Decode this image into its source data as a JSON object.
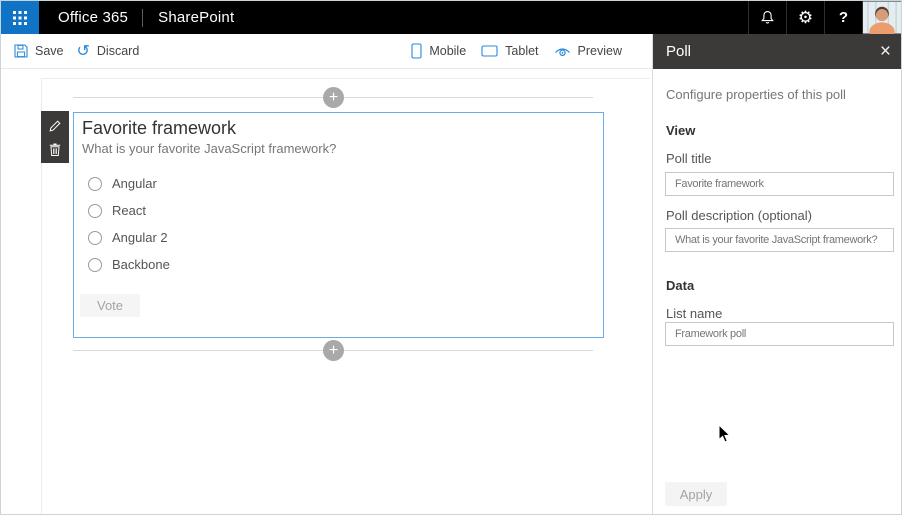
{
  "suite_bar": {
    "brand": "Office 365",
    "product": "SharePoint",
    "help_label": "?"
  },
  "toolbar": {
    "save_label": "Save",
    "discard_label": "Discard",
    "mobile_label": "Mobile",
    "tablet_label": "Tablet",
    "preview_label": "Preview"
  },
  "canvas": {
    "webpart": {
      "title": "Favorite framework",
      "description": "What is your favorite JavaScript framework?",
      "options": [
        "Angular",
        "React",
        "Angular 2",
        "Backbone"
      ],
      "vote_label": "Vote"
    }
  },
  "panel": {
    "title": "Poll",
    "subtitle": "Configure properties of this poll",
    "view": {
      "heading": "View",
      "poll_title_label": "Poll title",
      "poll_title_value": "Favorite framework",
      "poll_description_label": "Poll description (optional)",
      "poll_description_value": "What is your favorite JavaScript framework?"
    },
    "data": {
      "heading": "Data",
      "list_name_label": "List name",
      "list_name_value": "Framework poll"
    },
    "apply_label": "Apply"
  },
  "glyphs": {
    "add": "+",
    "close": "×",
    "undo": "↺",
    "gear": "⚙"
  },
  "icons": {
    "app_launcher": "waffle-grid-icon",
    "notifications": "bell-icon",
    "settings": "gear-icon",
    "help": "question-mark-icon",
    "account": "avatar-photo",
    "save": "floppy-disk-icon",
    "discard": "undo-arrow-icon",
    "mobile": "phone-outline-icon",
    "tablet": "tablet-outline-icon",
    "preview": "eye-icon",
    "edit": "pencil-icon",
    "delete": "trash-icon",
    "add_webpart": "plus-circle-icon",
    "close_panel": "x-icon"
  },
  "colors": {
    "chrome_black": "#000000",
    "app_launcher_blue": "#1073c6",
    "accent_blue": "#2b88d8",
    "selection_border_blue": "#6aace6",
    "dark_chrome": "#3b3a39",
    "disabled_button_bg": "#f4f4f4",
    "disabled_button_text": "#a3a3a3"
  }
}
